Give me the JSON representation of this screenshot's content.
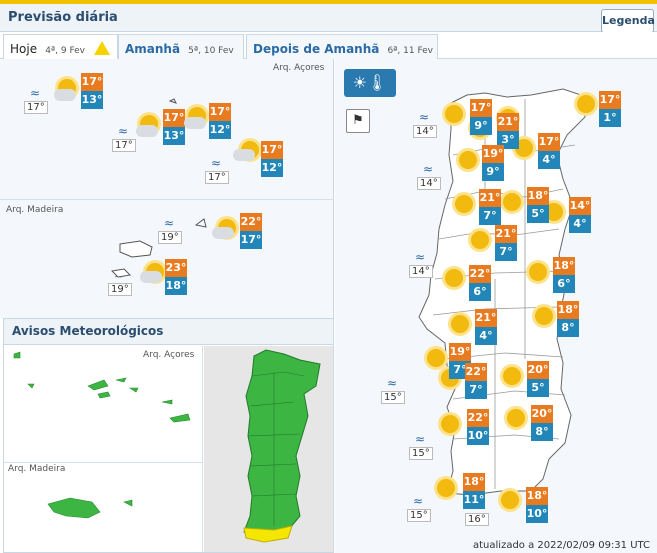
{
  "header": {
    "title": "Previsão diária",
    "legend_label": "Legenda"
  },
  "tabs": [
    {
      "label": "Hoje",
      "date": "4ª, 9 Fev",
      "warning": true
    },
    {
      "label": "Amanhã",
      "date": "5ª, 10 Fev"
    },
    {
      "label": "Depois de Amanhã",
      "date": "6ª, 11 Fev"
    }
  ],
  "acores": {
    "label": "Arq. Açores",
    "points": [
      {
        "tmax": "17°",
        "tmin": "13°",
        "icon": "sun-cloud-icon"
      },
      {
        "tmax": "17°",
        "tmin": "13°",
        "icon": "sun-cloud-icon"
      },
      {
        "tmax": "17°",
        "tmin": "12°",
        "icon": "sun-cloud-icon"
      },
      {
        "tmax": "17°",
        "tmin": "12°",
        "icon": "cloud-sun-icon"
      }
    ],
    "sea": [
      "17°",
      "17°",
      "17°"
    ]
  },
  "madeira": {
    "label": "Arq. Madeira",
    "points": [
      {
        "tmax": "22°",
        "tmin": "17°",
        "icon": "cloud-sun-icon"
      },
      {
        "tmax": "23°",
        "tmin": "18°",
        "icon": "cloud-sun-icon"
      }
    ],
    "sea": [
      "19°",
      "19°"
    ]
  },
  "avisos": {
    "title": "Avisos Meteorológicos",
    "acores_label": "Arq. Açores",
    "madeira_label": "Arq. Madeira"
  },
  "mainland": {
    "points": [
      {
        "tmax": "17°",
        "tmin": "9°"
      },
      {
        "tmax": "21°",
        "tmin": "3°"
      },
      {
        "tmax": "17°",
        "tmin": "1°"
      },
      {
        "tmax": "19°",
        "tmin": "9°"
      },
      {
        "tmax": "17°",
        "tmin": "4°"
      },
      {
        "tmax": "21°",
        "tmin": "7°"
      },
      {
        "tmax": "18°",
        "tmin": "5°"
      },
      {
        "tmax": "14°",
        "tmin": "4°"
      },
      {
        "tmax": "21°",
        "tmin": "7°"
      },
      {
        "tmax": "22°",
        "tmin": "6°"
      },
      {
        "tmax": "18°",
        "tmin": "6°"
      },
      {
        "tmax": "21°",
        "tmin": "4°"
      },
      {
        "tmax": "18°",
        "tmin": "8°"
      },
      {
        "tmax": "19°",
        "tmin": "7°"
      },
      {
        "tmax": "22°",
        "tmin": "7°"
      },
      {
        "tmax": "20°",
        "tmin": "5°"
      },
      {
        "tmax": "22°",
        "tmin": "10°"
      },
      {
        "tmax": "20°",
        "tmin": "8°"
      },
      {
        "tmax": "18°",
        "tmin": "11°"
      },
      {
        "tmax": "18°",
        "tmin": "10°"
      }
    ],
    "sea": [
      "14°",
      "14°",
      "14°",
      "15°",
      "15°",
      "15°",
      "16°"
    ]
  },
  "updated": "atualizado a 2022/02/09 09:31 UTC",
  "colors": {
    "tmax": "#e87a1f",
    "tmin": "#2386b8",
    "warning_green": "#3cb543",
    "warning_yellow": "#f5e600"
  }
}
